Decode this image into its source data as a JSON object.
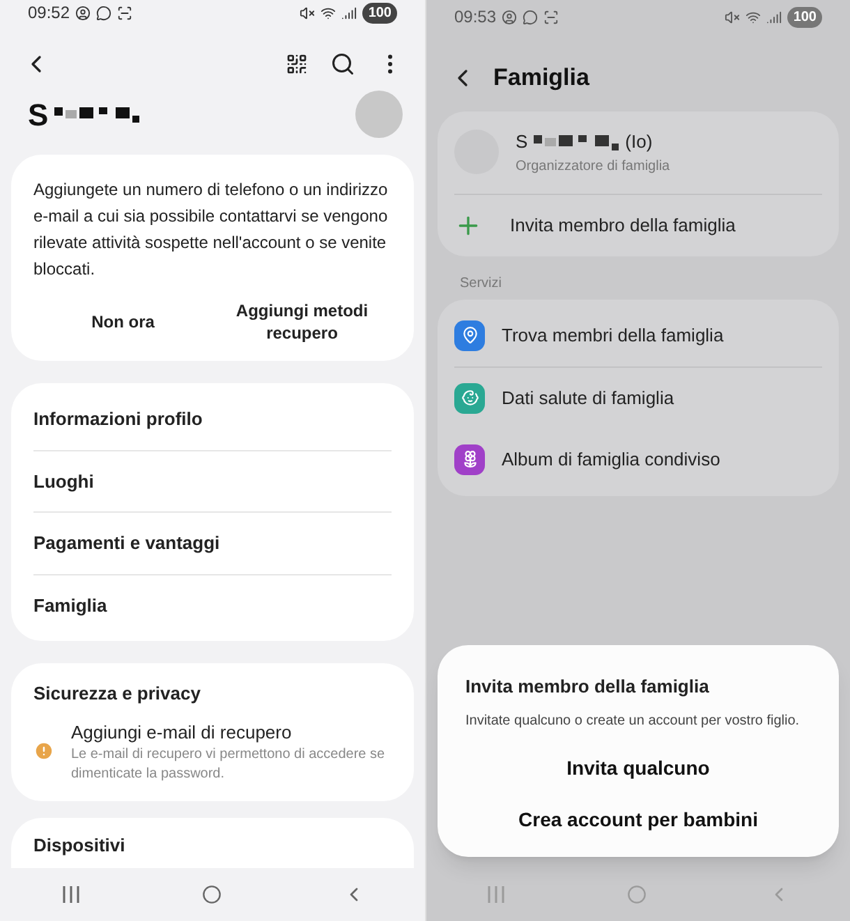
{
  "left": {
    "status_bar": {
      "time": "09:52",
      "battery": "100"
    },
    "profile": {
      "name": "S"
    },
    "recovery_card": {
      "text": "Aggiungete un numero di telefono o un indirizzo e-mail a cui sia possibile contattarvi se vengono rilevate attività sospette nell'account o se venite bloccati.",
      "buttons": [
        "Non ora",
        "Aggiungi metodi recupero"
      ]
    },
    "menu": [
      "Informazioni profilo",
      "Luoghi",
      "Pagamenti e vantaggi",
      "Famiglia"
    ],
    "security": {
      "title": "Sicurezza e privacy",
      "item_title": "Aggiungi e-mail di recupero",
      "item_description": "Le e-mail di recupero vi permettono di accedere se dimenticate la password."
    },
    "next_section": "Dispositivi"
  },
  "right": {
    "status_bar": {
      "time": "09:53",
      "battery": "100"
    },
    "title": "Famiglia",
    "member": {
      "name": "S",
      "suffix": "(Io)",
      "role": "Organizzatore di famiglia"
    },
    "invite_row": "Invita membro della famiglia",
    "services_label": "Servizi",
    "services": [
      {
        "kind": "location",
        "label": "Trova membri della famiglia",
        "color": "#2e7de0"
      },
      {
        "kind": "health",
        "label": "Dati salute di famiglia",
        "color": "#2aa893"
      },
      {
        "kind": "album",
        "label": "Album di famiglia condiviso",
        "color": "#a040c8"
      }
    ],
    "dialog": {
      "title": "Invita membro della famiglia",
      "text": "Invitate qualcuno o create un account per vostro figlio.",
      "buttons": [
        "Invita qualcuno",
        "Crea account per bambini"
      ]
    }
  }
}
